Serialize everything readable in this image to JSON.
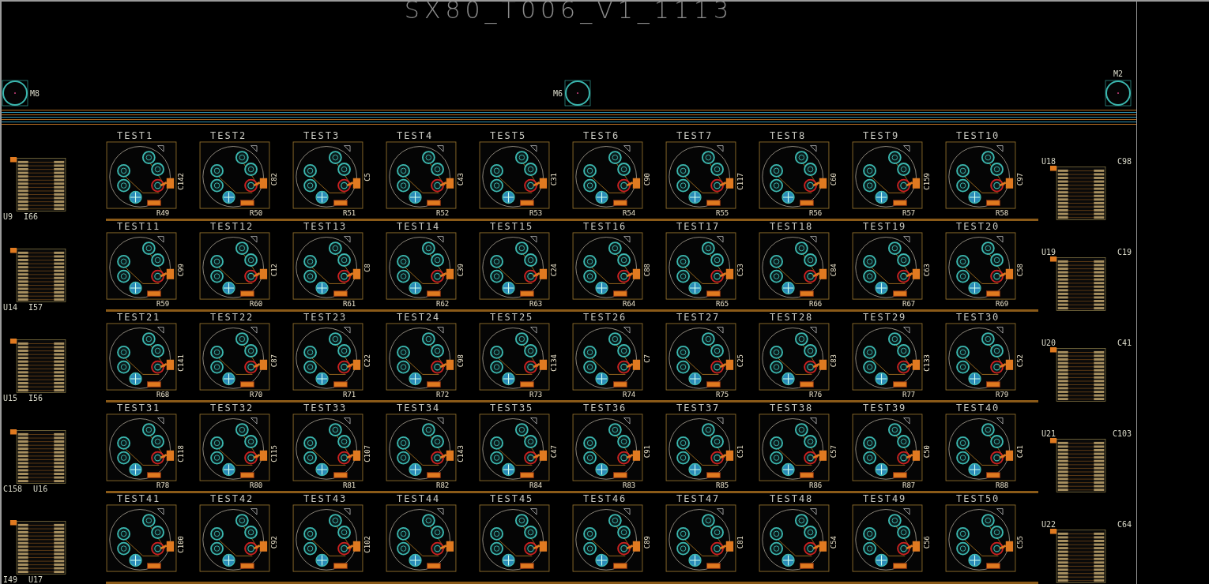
{
  "title": "SX80_T006_V1_1113",
  "mounting_holes": [
    {
      "label": "M8"
    },
    {
      "label": "M6"
    },
    {
      "label": "M2"
    }
  ],
  "left_connectors": [
    {
      "labels": [
        "U9",
        "I66"
      ]
    },
    {
      "labels": [
        "U14",
        "I57"
      ]
    },
    {
      "labels": [
        "U15",
        "I56"
      ]
    },
    {
      "labels": [
        "C158",
        "U16"
      ]
    },
    {
      "labels": [
        "I49",
        "U17"
      ]
    }
  ],
  "socket_rows": [
    [
      {
        "test": "TEST1",
        "cap": "C142",
        "res": "R49"
      },
      {
        "test": "TEST2",
        "cap": "C82",
        "res": "R50"
      },
      {
        "test": "TEST3",
        "cap": "C5",
        "res": "R51"
      },
      {
        "test": "TEST4",
        "cap": "C43",
        "res": "R52"
      },
      {
        "test": "TEST5",
        "cap": "C31",
        "res": "R53"
      },
      {
        "test": "TEST6",
        "cap": "C90",
        "res": "R54"
      },
      {
        "test": "TEST7",
        "cap": "C117",
        "res": "R55"
      },
      {
        "test": "TEST8",
        "cap": "C60",
        "res": "R56"
      },
      {
        "test": "TEST9",
        "cap": "C159",
        "res": "R57"
      },
      {
        "test": "TEST10",
        "cap": "C97",
        "res": "R58"
      }
    ],
    [
      {
        "test": "TEST11",
        "cap": "C99",
        "res": "R59"
      },
      {
        "test": "TEST12",
        "cap": "C12",
        "res": "R60"
      },
      {
        "test": "TEST13",
        "cap": "C8",
        "res": "R61"
      },
      {
        "test": "TEST14",
        "cap": "C39",
        "res": "R62"
      },
      {
        "test": "TEST15",
        "cap": "C24",
        "res": "R63"
      },
      {
        "test": "TEST16",
        "cap": "C88",
        "res": "R64"
      },
      {
        "test": "TEST17",
        "cap": "C53",
        "res": "R65"
      },
      {
        "test": "TEST18",
        "cap": "C84",
        "res": "R66"
      },
      {
        "test": "TEST19",
        "cap": "C63",
        "res": "R67"
      },
      {
        "test": "TEST20",
        "cap": "C58",
        "res": "R69"
      }
    ],
    [
      {
        "test": "TEST21",
        "cap": "C141",
        "res": "R68"
      },
      {
        "test": "TEST22",
        "cap": "C87",
        "res": "R70"
      },
      {
        "test": "TEST23",
        "cap": "C22",
        "res": "R71"
      },
      {
        "test": "TEST24",
        "cap": "C98",
        "res": "R72"
      },
      {
        "test": "TEST25",
        "cap": "C134",
        "res": "R73"
      },
      {
        "test": "TEST26",
        "cap": "C7",
        "res": "R74"
      },
      {
        "test": "TEST27",
        "cap": "C25",
        "res": "R75"
      },
      {
        "test": "TEST28",
        "cap": "C83",
        "res": "R76"
      },
      {
        "test": "TEST29",
        "cap": "C133",
        "res": "R77"
      },
      {
        "test": "TEST30",
        "cap": "C52",
        "res": "R79"
      }
    ],
    [
      {
        "test": "TEST31",
        "cap": "C118",
        "res": "R78"
      },
      {
        "test": "TEST32",
        "cap": "C115",
        "res": "R80"
      },
      {
        "test": "TEST33",
        "cap": "C107",
        "res": "R81"
      },
      {
        "test": "TEST34",
        "cap": "C143",
        "res": "R82"
      },
      {
        "test": "TEST35",
        "cap": "C47",
        "res": "R84"
      },
      {
        "test": "TEST36",
        "cap": "C91",
        "res": "R83"
      },
      {
        "test": "TEST37",
        "cap": "C51",
        "res": "R85"
      },
      {
        "test": "TEST38",
        "cap": "C57",
        "res": "R86"
      },
      {
        "test": "TEST39",
        "cap": "C50",
        "res": "R87"
      },
      {
        "test": "TEST40",
        "cap": "C41",
        "res": "R88"
      }
    ],
    [
      {
        "test": "TEST41",
        "cap": "C100"
      },
      {
        "test": "TEST42",
        "cap": "C92"
      },
      {
        "test": "TEST43",
        "cap": "C102"
      },
      {
        "test": "TEST44"
      },
      {
        "test": "TEST45"
      },
      {
        "test": "TEST46",
        "cap": "C89"
      },
      {
        "test": "TEST47",
        "cap": "C81"
      },
      {
        "test": "TEST48",
        "cap": "C54"
      },
      {
        "test": "TEST49",
        "cap": "C56"
      },
      {
        "test": "TEST50",
        "cap": "C55"
      }
    ]
  ],
  "right_connectors": [
    {
      "ref": "U18",
      "cap": "C98"
    },
    {
      "ref": "U19",
      "cap": "C19"
    },
    {
      "ref": "U20",
      "cap": "C41"
    },
    {
      "ref": "U21",
      "cap": "C103"
    },
    {
      "ref": "U22",
      "cap": "C64"
    }
  ]
}
